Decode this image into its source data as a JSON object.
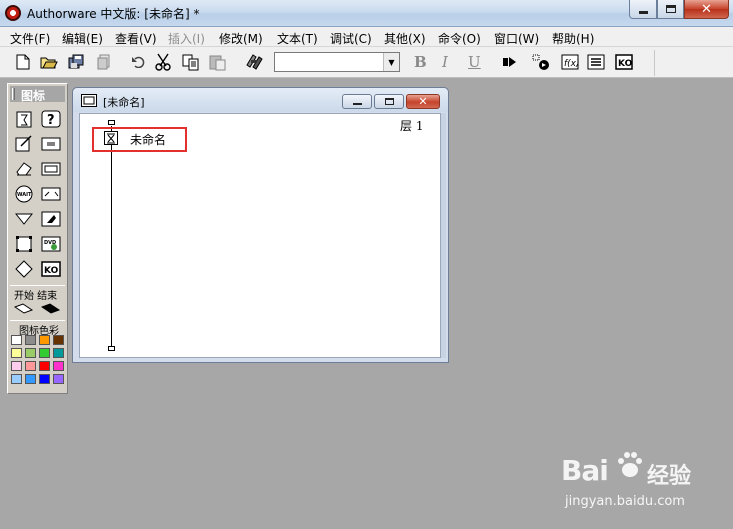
{
  "window": {
    "title": "Authorware 中文版: [未命名] *",
    "app_icon": "authorware-logo-icon",
    "controls": [
      "minimize-icon",
      "maximize-icon",
      "close-icon"
    ]
  },
  "menubar": {
    "items": [
      {
        "label": "文件(F)",
        "enabled": true
      },
      {
        "label": "编辑(E)",
        "enabled": true
      },
      {
        "label": "查看(V)",
        "enabled": true
      },
      {
        "label": "插入(I)",
        "enabled": false
      },
      {
        "label": "修改(M)",
        "enabled": true
      },
      {
        "label": "文本(T)",
        "enabled": true
      },
      {
        "label": "调试(C)",
        "enabled": true
      },
      {
        "label": "其他(X)",
        "enabled": true
      },
      {
        "label": "命令(O)",
        "enabled": true
      },
      {
        "label": "窗口(W)",
        "enabled": true
      },
      {
        "label": "帮助(H)",
        "enabled": true
      }
    ]
  },
  "toolbar": {
    "buttons": [
      "new-file-icon",
      "open-file-icon",
      "save-all-icon",
      "import-icon",
      "undo-icon",
      "cut-icon",
      "copy-icon",
      "paste-icon",
      "find-icon",
      "text-style-combo",
      "bold-icon",
      "italic-icon",
      "underline-icon",
      "run-icon",
      "control-panel-icon",
      "functions-icon",
      "variables-icon",
      "knowledge-objects-icon"
    ],
    "font_style_value": "",
    "bold": "B",
    "italic": "I",
    "underline": "U"
  },
  "palette": {
    "title": "图标",
    "icons": [
      "display-icon",
      "interaction-icon",
      "calculation-icon",
      "decision-icon",
      "erase-icon",
      "framework-icon",
      "wait-icon",
      "navigate-icon",
      "motion-icon",
      "digital-movie-icon",
      "sound-icon",
      "video-icon",
      "map-icon",
      "knowledge-object-icon"
    ],
    "flag_label": "开始 结束",
    "color_label": "图标色彩",
    "colors": [
      "#ffffff",
      "#8c8c8c",
      "#ff9900",
      "#663300",
      "#ffff99",
      "#99cc66",
      "#33cc33",
      "#009999",
      "#ffccee",
      "#ff9999",
      "#ff0000",
      "#ff33cc",
      "#99ccff",
      "#3399ff",
      "#0000ff",
      "#9966ff"
    ]
  },
  "document": {
    "title": "[未命名]",
    "level_label": "层 1",
    "node": {
      "label": "未命名",
      "icon": "map-icon",
      "highlight_color": "#e2302c"
    }
  },
  "watermark": {
    "brand": "Bai",
    "brand_suffix": "经验",
    "url": "jingyan.baidu.com"
  }
}
